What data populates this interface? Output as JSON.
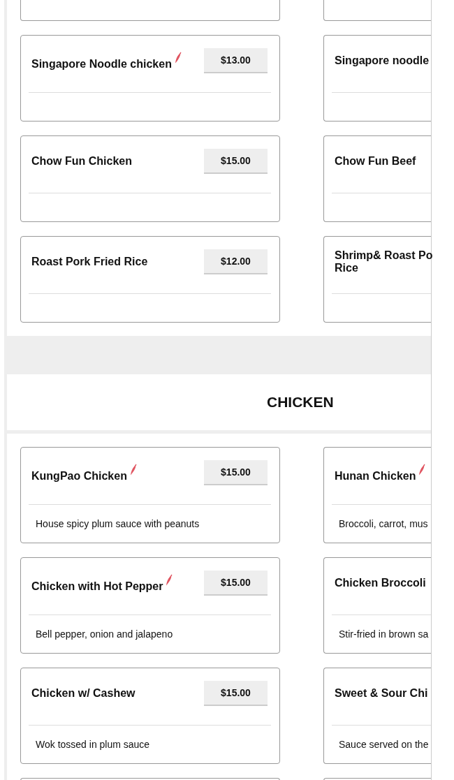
{
  "sections": [
    {
      "rows": [
        [
          {
            "kind": "cut-bottom"
          },
          {
            "kind": "cut-bottom"
          }
        ],
        [
          {
            "kind": "dish",
            "name": "Singapore Noodle chicken",
            "spicy": true,
            "price": "$13.00"
          },
          {
            "kind": "dish",
            "name": "Singapore noodle",
            "spicy": false
          }
        ],
        [
          {
            "kind": "dish",
            "name": "Chow Fun Chicken",
            "spicy": false,
            "price": "$15.00"
          },
          {
            "kind": "dish",
            "name": "Chow Fun Beef",
            "spicy": false
          }
        ],
        [
          {
            "kind": "dish",
            "name": "Roast Pork Fried Rice",
            "spicy": false,
            "price": "$12.00"
          },
          {
            "kind": "dish",
            "name": "Shrimp& Roast Po\nRice",
            "spicy": false
          }
        ]
      ]
    },
    {
      "title": "CHICKEN",
      "rows": [
        [
          {
            "kind": "dish",
            "name": "KungPao Chicken",
            "spicy": true,
            "price": "$15.00",
            "description": "House spicy plum sauce with peanuts"
          },
          {
            "kind": "dish",
            "name": "Hunan Chicken",
            "spicy": true,
            "description": "Broccoli, carrot, mus"
          }
        ],
        [
          {
            "kind": "dish",
            "name": "Chicken with Hot Pepper",
            "spicy": true,
            "price": "$15.00",
            "description": "Bell pepper, onion and jalapeno"
          },
          {
            "kind": "dish",
            "name": "Chicken Broccoli",
            "spicy": false,
            "description": "Stir-fried in brown sa"
          }
        ],
        [
          {
            "kind": "dish",
            "name": "Chicken w/ Cashew",
            "spicy": false,
            "price": "$15.00",
            "description": "Wok tossed in plum sauce"
          },
          {
            "kind": "dish",
            "name": "Sweet & Sour Chi",
            "spicy": false,
            "description": "Sauce served on the"
          }
        ],
        [
          {
            "kind": "cut-top"
          },
          {
            "kind": "cut-top"
          }
        ]
      ]
    }
  ]
}
